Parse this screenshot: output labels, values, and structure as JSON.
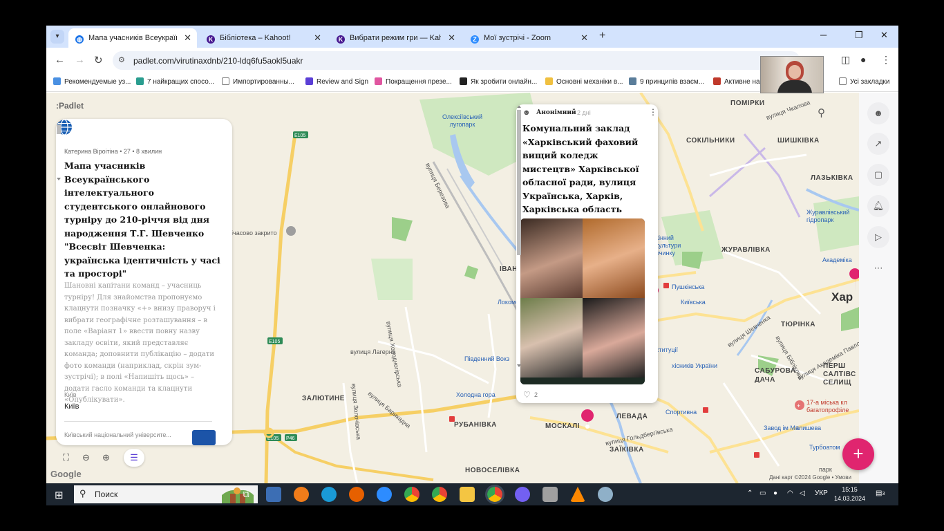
{
  "browser": {
    "tabs": [
      {
        "label": "Мапа учасників Всеукраїнськ...",
        "active": true,
        "favicon": "globe-icon",
        "color": "#1a73e8"
      },
      {
        "label": "Бібліотека – Kahoot!",
        "active": false,
        "favicon": "kahoot-icon",
        "color": "#46178f"
      },
      {
        "label": "Вибрати режим гри — Kahoot!",
        "active": false,
        "favicon": "kahoot-icon",
        "color": "#46178f"
      },
      {
        "label": "Мої зустрічі - Zoom",
        "active": false,
        "favicon": "zoom-icon",
        "color": "#2d8cff"
      }
    ],
    "url": "padlet.com/virutinaxdnb/210-ldq6fu5aokl5uakr",
    "bookmarks": [
      {
        "label": "Рекомендуемые уз...",
        "color": "#4a90e2"
      },
      {
        "label": "7 найкращих спосо...",
        "color": "#2a9d8f"
      },
      {
        "label": "Импортированны...",
        "color": "#777777"
      },
      {
        "label": "Review and Sign",
        "color": "#5b3fd6"
      },
      {
        "label": "Покращення презе...",
        "color": "#e056a0"
      },
      {
        "label": "Як зробити онлайн...",
        "color": "#222222"
      },
      {
        "label": "Основні механіки в...",
        "color": "#f0c040"
      },
      {
        "label": "9 принципів взаєм...",
        "color": "#5a7d9a"
      },
      {
        "label": "Активне на",
        "color": "#c0392b"
      }
    ],
    "all_bookmarks": "Усі закладки"
  },
  "padlet": {
    "logo": ":Padlet",
    "info_card": {
      "author": "Катерина Віроітіна",
      "count": "27",
      "time": "8 хвилин",
      "title": "Мапа учасників Всеукраїнського інтелектуального студентського онлайнового турніру до 210-річчя від дня народження Т.Г. Шевченко \"Всесвіт Шевченка: українська ідентичність у часі та просторі\"",
      "description": "Шановні капітани команд – учасниць турніру! Для знайомства пропонуємо клацнути позначку «+» внизу праворуч і вибрати географічне розташування – в поле «Варіант 1» ввести повну назву закладу освіти, який представляє команда; доповнити публікацію – додати фото команди (наприклад, скрін зум-зустрічі); в полі «Напишіть щось» – додати гасло команди та клацнути «Опублікувати».",
      "section_label": "Київ",
      "section_value": "Київ",
      "next_item": "Київський національний університе..."
    },
    "post": {
      "author": "Анонімний",
      "time": "2 дні",
      "title": "Комунальний заклад «Харківський фаховий вищий коледж мистецтв» Харківської обласної ради, вулиця Українська, Харків, Харківська область",
      "likes": "2"
    },
    "accent": "#e0256f"
  },
  "map": {
    "district_labels": [
      {
        "text": "ПОМІРКИ"
      },
      {
        "text": "СОКІЛЬНИКИ"
      },
      {
        "text": "ШИШКІВКА"
      },
      {
        "text": "ЛАЗЬКІВКА"
      },
      {
        "text": "ЖУРАВЛІВКА"
      },
      {
        "text": "ТЮРІНКА"
      },
      {
        "text": "САБУРОВА ДАЧА"
      },
      {
        "text": "ЗАЛЮТИНЕ"
      },
      {
        "text": "РУБАНІВКА"
      },
      {
        "text": "МОСКАЛІ"
      },
      {
        "text": "ЛЕВАДА"
      },
      {
        "text": "ЗАЇКІВКА"
      },
      {
        "text": "НОВОСЕЛІВКА"
      },
      {
        "text": "ІВАН"
      },
      {
        "text": "ПЕРШ САЛТІВС СЕЛИЩ"
      }
    ],
    "poi_labels": [
      {
        "text": "Олексіївський лугопарк"
      },
      {
        "text": "Журавлівський гідропарк"
      },
      {
        "text": "Академіка"
      },
      {
        "text": "Пушкінська"
      },
      {
        "text": "Київська"
      },
      {
        "text": "Локомоти"
      },
      {
        "text": "Південний Вокз"
      },
      {
        "text": "Холодна гора"
      },
      {
        "text": "Спортивна"
      },
      {
        "text": "хісників України"
      },
      {
        "text": "17-а міська кл багатопрофіле"
      },
      {
        "text": "Завод ім Малишева"
      },
      {
        "text": "Турбоатом"
      },
      {
        "text": "Хар"
      },
      {
        "text": "ічасово закрито"
      },
      {
        "text": "кінний культури очинку"
      },
      {
        "text": "ституції"
      },
      {
        "text": "парк"
      }
    ],
    "street_labels": [
      {
        "text": "вулиця Лагерна"
      },
      {
        "text": "вулиця Холодногірська"
      },
      {
        "text": "вулиця Золочівська"
      },
      {
        "text": "вулиця Гольдбергівська"
      },
      {
        "text": "вулиця Чкалова"
      },
      {
        "text": "вулиця Березова"
      },
      {
        "text": "вулиця Шевченка"
      },
      {
        "text": "вулиця Біблікова"
      },
      {
        "text": "вулиця Академіка Павлова"
      },
      {
        "text": "вулиця Барикадна"
      }
    ],
    "road_labels": [
      "E105",
      "E105",
      "E105",
      "P46"
    ],
    "attribution": "Дані карт ©2024 Google • Умови",
    "google": "Google"
  },
  "taskbar": {
    "search": "Поиск",
    "lang": "УКР",
    "time": "15:15",
    "date": "14.03.2024",
    "notif": "3"
  }
}
